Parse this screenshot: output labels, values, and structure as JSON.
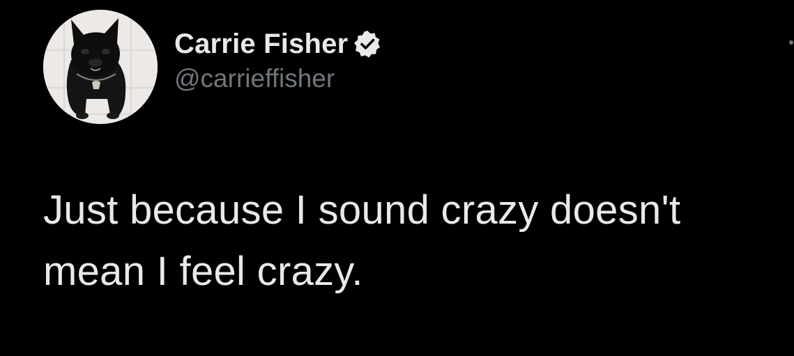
{
  "tweet": {
    "author": {
      "display_name": "Carrie Fisher",
      "handle": "@carrieffisher",
      "verified": true,
      "avatar_icon": "french-bulldog-avatar"
    },
    "more_icon": "more-options-icon",
    "text": "Just because I sound crazy doesn't mean I feel crazy."
  },
  "colors": {
    "background": "#000000",
    "primary_text": "#e7e9ea",
    "secondary_text": "#71767b",
    "verified_badge": "#e7e9ea"
  }
}
